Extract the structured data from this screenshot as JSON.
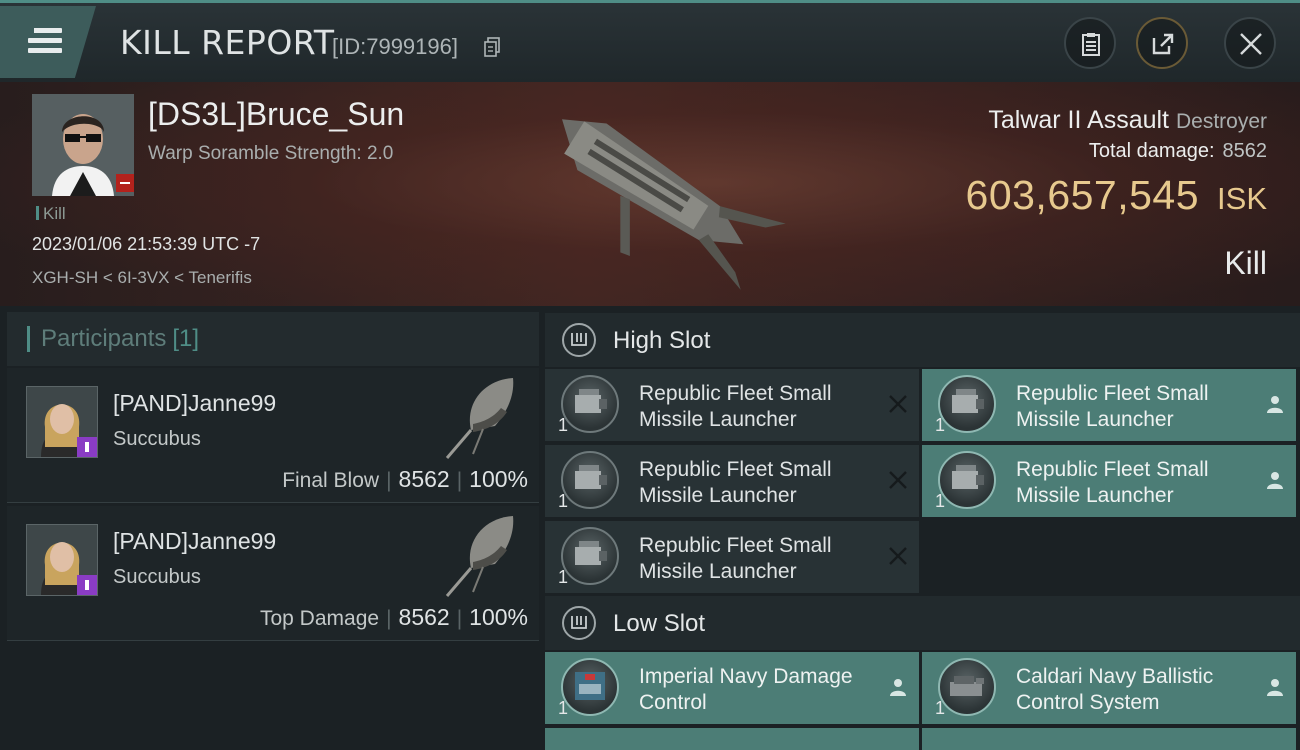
{
  "header": {
    "title": "KILL REPORT",
    "report_id": "[ID:7999196]"
  },
  "victim": {
    "name": "[DS3L]Bruce_Sun",
    "warp_scramble": "Warp Soramble Strength: 2.0",
    "kill_tag": "Kill",
    "time": "2023/01/06 21:53:39 UTC -7",
    "location": "XGH-SH < 6I-3VX < Tenerifis",
    "ship_name": "Talwar II Assault",
    "ship_class": "Destroyer",
    "total_damage_label": "Total damage:",
    "total_damage": "8562",
    "isk_value": "603,657,545",
    "isk_unit": "ISK",
    "result": "Kill"
  },
  "participants": {
    "label": "Participants",
    "count": "[1]",
    "rows": [
      {
        "name": "[PAND]Janne99",
        "ship": "Succubus",
        "role": "Final Blow",
        "damage": "8562",
        "percent": "100%"
      },
      {
        "name": "[PAND]Janne99",
        "ship": "Succubus",
        "role": "Top Damage",
        "damage": "8562",
        "percent": "100%"
      }
    ]
  },
  "high_slot": {
    "label": "High Slot",
    "modules": [
      {
        "name": "Republic Fleet Small Missile Launcher",
        "qty": "1",
        "status": "destroyed"
      },
      {
        "name": "Republic Fleet Small Missile Launcher",
        "qty": "1",
        "status": "dropped"
      },
      {
        "name": "Republic Fleet Small Missile Launcher",
        "qty": "1",
        "status": "destroyed"
      },
      {
        "name": "Republic Fleet Small Missile Launcher",
        "qty": "1",
        "status": "dropped"
      },
      {
        "name": "Republic Fleet Small Missile Launcher",
        "qty": "1",
        "status": "destroyed"
      }
    ]
  },
  "low_slot": {
    "label": "Low Slot",
    "modules": [
      {
        "name": "Imperial Navy Damage Control",
        "qty": "1",
        "status": "dropped"
      },
      {
        "name": "Caldari Navy Ballistic Control System",
        "qty": "1",
        "status": "dropped"
      }
    ]
  },
  "colors": {
    "accent": "#4f8d86",
    "isk": "#e7c98e",
    "fitted_module": "#4c7d76"
  }
}
